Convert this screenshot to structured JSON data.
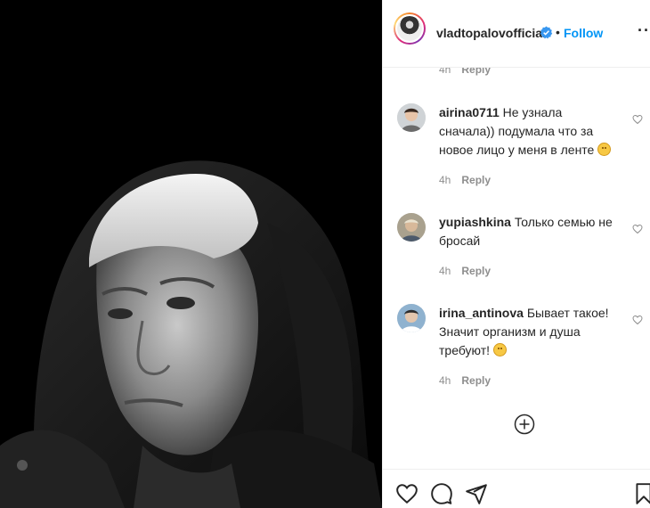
{
  "post": {
    "username": "vladtopalovofficial",
    "separator": "•",
    "follow_label": "Follow",
    "more_label": "···",
    "verified": true
  },
  "partial_meta": {
    "time": "4h",
    "reply": "Reply"
  },
  "comments": [
    {
      "username": "airina0711",
      "text": "Не узнала сначала)) подумала что за новое лицо у меня в ленте",
      "emoji": "smiling-face",
      "time": "4h",
      "reply": "Reply"
    },
    {
      "username": "yupiashkina",
      "text": "Только семью не бросай",
      "time": "4h",
      "reply": "Reply"
    },
    {
      "username": "irina_antinova",
      "text": "Бывает такое! Значит организм и душа требуют!",
      "emoji": "hugging-face",
      "time": "4h",
      "reply": "Reply"
    }
  ],
  "icons": {
    "load_more": "plus-circle-icon",
    "like": "heart-icon",
    "comment": "comment-icon",
    "share": "paper-plane-icon",
    "save": "bookmark-icon"
  },
  "colors": {
    "accent": "#0095f6",
    "verified": "#3897f0",
    "muted": "#8e8e8e",
    "text": "#262626"
  }
}
